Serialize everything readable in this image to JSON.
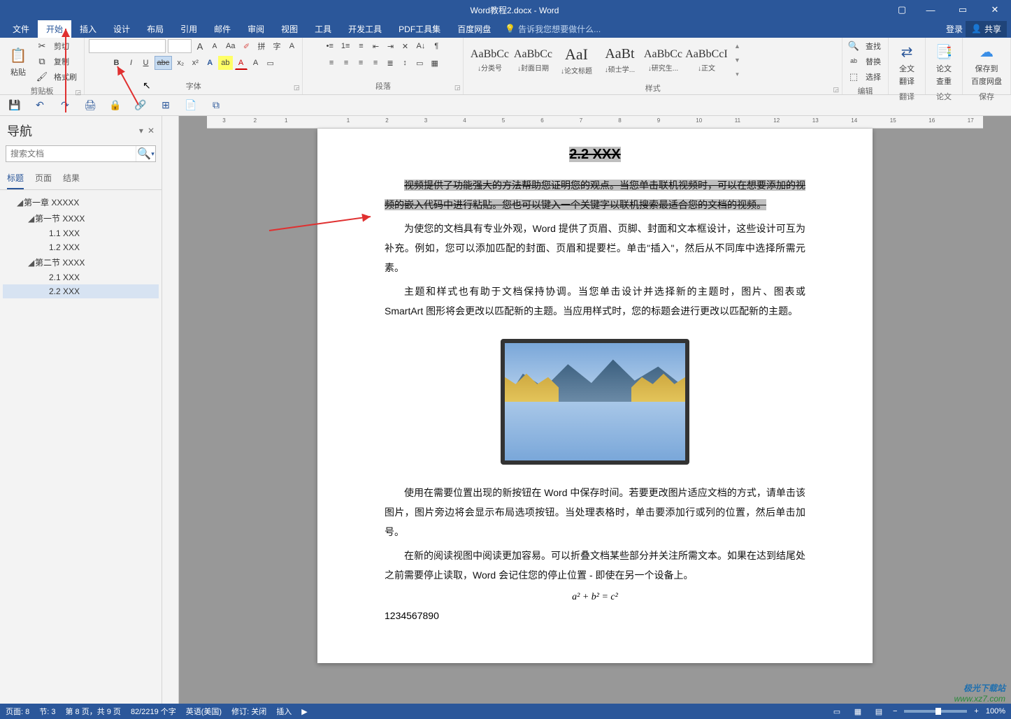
{
  "title": "Word教程2.docx - Word",
  "window_controls": {
    "ribbon_opts": "⌄",
    "minimize": "—",
    "maximize": "▭",
    "close": "✕",
    "caret": "▢"
  },
  "menubar": {
    "tabs": [
      "文件",
      "开始",
      "插入",
      "设计",
      "布局",
      "引用",
      "邮件",
      "审阅",
      "视图",
      "工具",
      "开发工具",
      "PDF工具集",
      "百度网盘"
    ],
    "active_index": 1,
    "tell_me_placeholder": "告诉我您想要做什么...",
    "login": "登录",
    "share": "共享"
  },
  "ribbon": {
    "clipboard": {
      "paste": "粘贴",
      "cut": "剪切",
      "copy": "复制",
      "format_painter": "格式刷",
      "label": "剪贴板"
    },
    "font": {
      "name": "",
      "size": "",
      "grow": "A",
      "shrink": "A",
      "case": "Aa",
      "clear": "✎",
      "pinyin": "拼",
      "enclose": "字",
      "charborder": "A",
      "bold": "B",
      "italic": "I",
      "underline": "U",
      "strike": "abc",
      "sub": "x₂",
      "sup": "x²",
      "texteffect": "A",
      "highlight": "ab",
      "fontcolor": "A",
      "charshade": "A",
      "border": "▭",
      "label": "字体"
    },
    "paragraph": {
      "bullets": "•≡",
      "numbering": "1≡",
      "multilevel": "≡",
      "dec_indent": "⇤",
      "inc_indent": "⇥",
      "sort": "A↓",
      "cjk": "✕",
      "showmarks": "¶",
      "align_l": "≡",
      "align_c": "≡",
      "align_r": "≡",
      "align_j": "≡",
      "distribute": "≣",
      "linespace": "↕",
      "shading": "▭",
      "borders": "▦",
      "label": "段落"
    },
    "styles": {
      "items": [
        {
          "preview": "AaBbCc",
          "name": "↓分类号"
        },
        {
          "preview": "AaBbCc",
          "name": "↓封面日期"
        },
        {
          "preview": "AaI",
          "name": "↓论文标题"
        },
        {
          "preview": "AaBt",
          "name": "↓硕士学..."
        },
        {
          "preview": "AaBbCc",
          "name": "↓研究生..."
        },
        {
          "preview": "AaBbCcI",
          "name": "↓正文"
        }
      ],
      "label": "样式"
    },
    "editing": {
      "find": "查找",
      "replace": "替换",
      "select": "选择",
      "label": "编辑"
    },
    "addons": {
      "translate": {
        "l1": "全文",
        "l2": "翻译",
        "grp": "翻译"
      },
      "lookup": {
        "l1": "论文",
        "l2": "查重",
        "grp": "论文"
      },
      "baidu": {
        "l1": "保存到",
        "l2": "百度网盘",
        "grp": "保存"
      }
    }
  },
  "qat": [
    "💾",
    "↶",
    "↷",
    "🖨",
    "🔒",
    "🔗",
    "⊞",
    "📄",
    "⧉"
  ],
  "nav": {
    "title": "导航",
    "search_placeholder": "搜索文档",
    "tabs": [
      "标题",
      "页面",
      "结果"
    ],
    "active_tab": 0,
    "tree": [
      {
        "lvl": 1,
        "caret": "◢",
        "text": "第一章 XXXXX"
      },
      {
        "lvl": 2,
        "caret": "◢",
        "text": "第一节 XXXX"
      },
      {
        "lvl": 3,
        "caret": "",
        "text": "1.1 XXX"
      },
      {
        "lvl": 3,
        "caret": "",
        "text": "1.2 XXX"
      },
      {
        "lvl": 2,
        "caret": "◢",
        "text": "第二节 XXXX"
      },
      {
        "lvl": 3,
        "caret": "",
        "text": "2.1 XXX"
      },
      {
        "lvl": 3,
        "caret": "",
        "text": "2.2 XXX",
        "selected": true
      }
    ]
  },
  "ruler": {
    "h_marks": [
      "3",
      "2",
      "1",
      "",
      "1",
      "2",
      "3",
      "4",
      "5",
      "6",
      "7",
      "8",
      "9",
      "10",
      "11",
      "12",
      "13",
      "14",
      "15",
      "16",
      "17"
    ]
  },
  "document": {
    "heading": "2.2 XXX",
    "p1_sel": "视频提供了功能强大的方法帮助您证明您的观点。当您单击联机视频时，可以在想要添加的视频的嵌入代码中进行粘贴。您也可以键入一个关键字以联机搜索最适合您的文档的视频。",
    "p2": "为使您的文档具有专业外观，Word 提供了页眉、页脚、封面和文本框设计，这些设计可互为补充。例如，您可以添加匹配的封面、页眉和提要栏。单击\"插入\"，然后从不同库中选择所需元素。",
    "p3": "主题和样式也有助于文档保持协调。当您单击设计并选择新的主题时，图片、图表或 SmartArt 图形将会更改以匹配新的主题。当应用样式时，您的标题会进行更改以匹配新的主题。",
    "p4": "使用在需要位置出现的新按钮在 Word 中保存时间。若要更改图片适应文档的方式，请单击该图片，图片旁边将会显示布局选项按钮。当处理表格时，单击要添加行或列的位置，然后单击加号。",
    "p5": "在新的阅读视图中阅读更加容易。可以折叠文档某些部分并关注所需文本。如果在达到结尾处之前需要停止读取，Word 会记住您的停止位置 - 即使在另一个设备上。",
    "formula": "a² + b² = c²",
    "numbers": "1234567890"
  },
  "statusbar": {
    "page": "页面: 8",
    "section": "节: 3",
    "pageof": "第 8 页，共 9 页",
    "words": "82/2219 个字",
    "lang": "英语(美国)",
    "track": "修订: 关闭",
    "insert": "插入",
    "zoom": "100%"
  },
  "watermark": {
    "l1": "极光下载站",
    "l2": "www.xz7.com"
  }
}
